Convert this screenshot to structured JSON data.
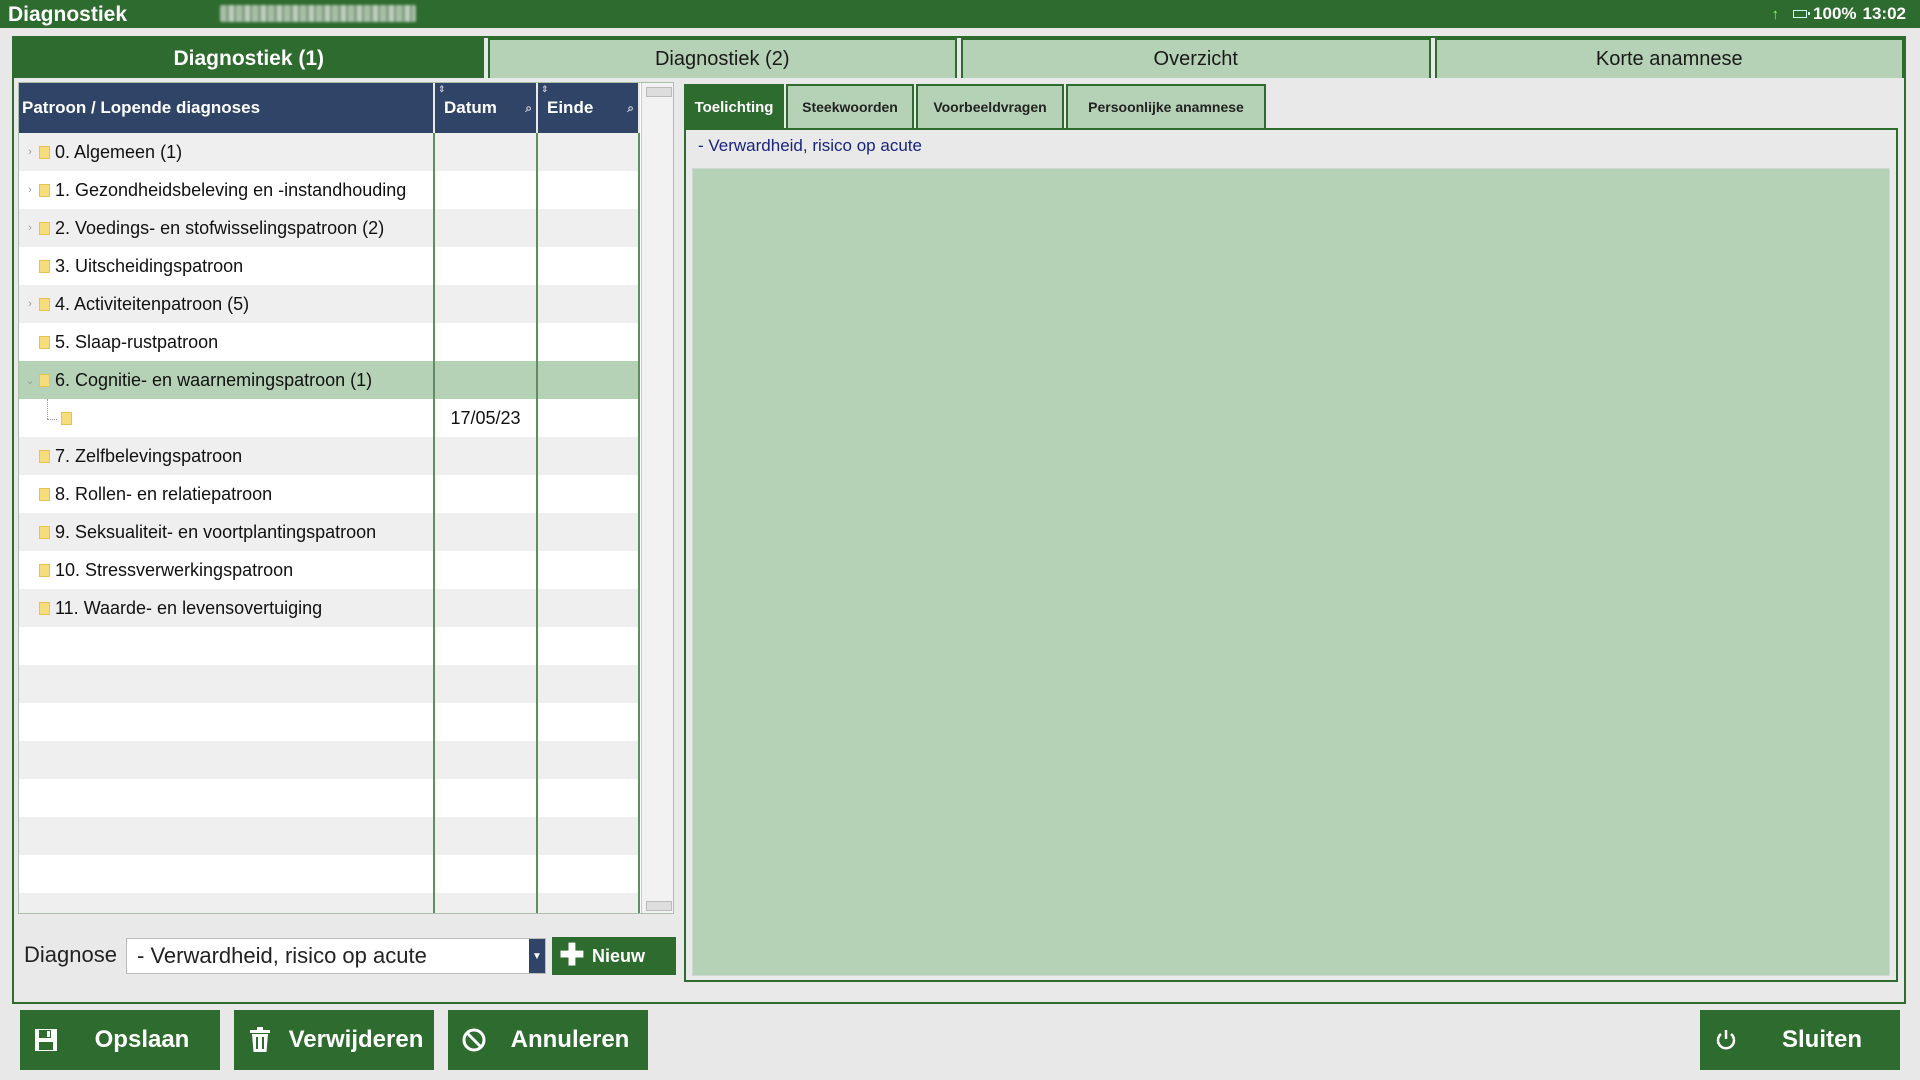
{
  "window": {
    "title": "Diagnostiek",
    "status": {
      "battery": "100%",
      "time": "13:02"
    }
  },
  "top_tabs": [
    {
      "label": "Diagnostiek (1)",
      "active": true
    },
    {
      "label": "Diagnostiek (2)",
      "active": false
    },
    {
      "label": "Overzicht",
      "active": false
    },
    {
      "label": "Korte anamnese",
      "active": false
    }
  ],
  "grid": {
    "columns": [
      "Patroon / Lopende diagnoses",
      "Datum",
      "Einde"
    ],
    "rows": [
      {
        "label": "0. Algemeen (1)",
        "datum": "",
        "einde": "",
        "expander": true,
        "selected": false,
        "child": false
      },
      {
        "label": "1. Gezondheidsbeleving en -instandhouding",
        "datum": "",
        "einde": "",
        "expander": true,
        "selected": false,
        "child": false
      },
      {
        "label": "2. Voedings- en stofwisselingspatroon (2)",
        "datum": "",
        "einde": "",
        "expander": true,
        "selected": false,
        "child": false
      },
      {
        "label": "3. Uitscheidingspatroon",
        "datum": "",
        "einde": "",
        "expander": false,
        "selected": false,
        "child": false
      },
      {
        "label": "4. Activiteitenpatroon (5)",
        "datum": "",
        "einde": "",
        "expander": true,
        "selected": false,
        "child": false
      },
      {
        "label": "5. Slaap-rustpatroon",
        "datum": "",
        "einde": "",
        "expander": false,
        "selected": false,
        "child": false
      },
      {
        "label": "6. Cognitie- en waarnemingspatroon (1)",
        "datum": "",
        "einde": "",
        "expander": true,
        "selected": true,
        "child": false
      },
      {
        "label": "",
        "datum": "17/05/23",
        "einde": "",
        "expander": false,
        "selected": false,
        "child": true
      },
      {
        "label": "7. Zelfbelevingspatroon",
        "datum": "",
        "einde": "",
        "expander": false,
        "selected": false,
        "child": false
      },
      {
        "label": "8. Rollen- en relatiepatroon",
        "datum": "",
        "einde": "",
        "expander": false,
        "selected": false,
        "child": false
      },
      {
        "label": "9. Seksualiteit- en voortplantingspatroon",
        "datum": "",
        "einde": "",
        "expander": false,
        "selected": false,
        "child": false
      },
      {
        "label": "10. Stressverwerkingspatroon",
        "datum": "",
        "einde": "",
        "expander": false,
        "selected": false,
        "child": false
      },
      {
        "label": "11. Waarde- en levensovertuiging",
        "datum": "",
        "einde": "",
        "expander": false,
        "selected": false,
        "child": false
      },
      {
        "label": "",
        "datum": "",
        "einde": "",
        "expander": false,
        "selected": false,
        "child": false,
        "empty": true
      },
      {
        "label": "",
        "datum": "",
        "einde": "",
        "expander": false,
        "selected": false,
        "child": false,
        "empty": true
      },
      {
        "label": "",
        "datum": "",
        "einde": "",
        "expander": false,
        "selected": false,
        "child": false,
        "empty": true
      },
      {
        "label": "",
        "datum": "",
        "einde": "",
        "expander": false,
        "selected": false,
        "child": false,
        "empty": true
      },
      {
        "label": "",
        "datum": "",
        "einde": "",
        "expander": false,
        "selected": false,
        "child": false,
        "empty": true
      },
      {
        "label": "",
        "datum": "",
        "einde": "",
        "expander": false,
        "selected": false,
        "child": false,
        "empty": true
      },
      {
        "label": "",
        "datum": "",
        "einde": "",
        "expander": false,
        "selected": false,
        "child": false,
        "empty": true
      },
      {
        "label": "",
        "datum": "",
        "einde": "",
        "expander": false,
        "selected": false,
        "child": false,
        "empty": true
      }
    ]
  },
  "diagnose": {
    "label": "Diagnose",
    "value": "- Verwardheid, risico op acute",
    "new_button": "Nieuw"
  },
  "detail": {
    "tabs": [
      "Toelichting",
      "Steekwoorden",
      "Voorbeeldvragen",
      "Persoonlijke anamnese"
    ],
    "active_tab": 0,
    "title": "- Verwardheid, risico op acute",
    "body": ""
  },
  "actions": {
    "save": "Opslaan",
    "delete": "Verwijderen",
    "cancel": "Annuleren",
    "close": "Sluiten"
  },
  "colors": {
    "primary_green": "#2e6b2e",
    "light_green": "#b6d2b6",
    "header_navy": "#2f4466",
    "title_blue": "#1a237e"
  }
}
